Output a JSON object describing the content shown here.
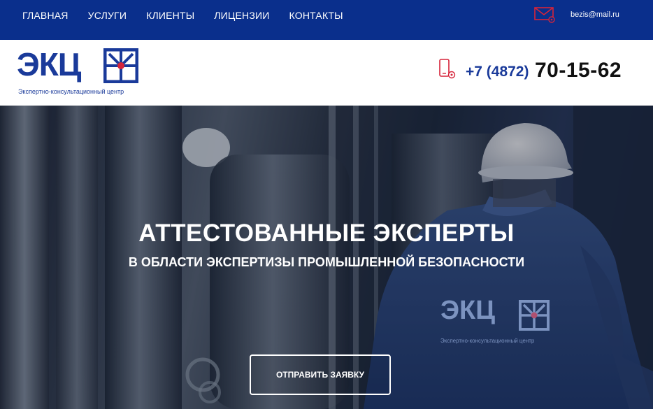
{
  "nav": {
    "items": [
      "ГЛАВНАЯ",
      "УСЛУГИ",
      "КЛИЕНТЫ",
      "ЛИЦЕНЗИИ",
      "КОНТАКТЫ"
    ]
  },
  "contact": {
    "email": "bezis@mail.ru",
    "phone_prefix": "+7 (4872)",
    "phone_main": "70-15-62"
  },
  "brand": {
    "logo_text": "ЭКЦ",
    "logo_subtitle": "Экспертно-консультационный центр",
    "primary_color": "#0a2f8c",
    "accent_color": "#d6243a"
  },
  "hero": {
    "title": "АТТЕСТОВАННЫЕ ЭКСПЕРТЫ",
    "subtitle": "В ОБЛАСТИ ЭКСПЕРТИЗЫ ПРОМЫШЛЕННОЙ БЕЗОПАСНОСТИ",
    "cta_label": "ОТПРАВИТЬ ЗАЯВКУ",
    "jacket_logo": "ЭКЦ",
    "jacket_subtitle": "Экспертно-консультационный центр"
  }
}
